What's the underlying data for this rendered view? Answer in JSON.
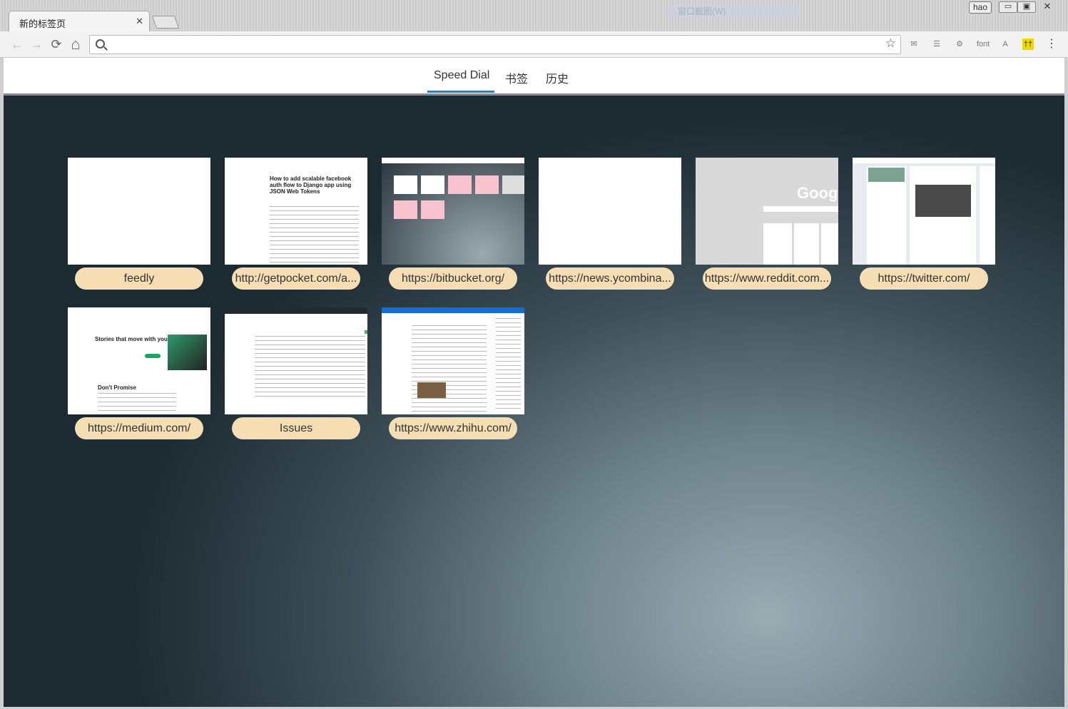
{
  "window": {
    "tab_title": "新的标签页",
    "tab_close": "✕",
    "user": "hao",
    "minimize": "▭",
    "restore": "▣",
    "close": "✕",
    "ghost_text": "窗口截图(W)"
  },
  "toolbar": {
    "back": "←",
    "forward": "→",
    "reload": "⟳",
    "home": "⌂",
    "address_value": "",
    "star": "☆",
    "extensions": [
      "✉",
      "☰",
      "⚙",
      "font",
      "A",
      "††",
      "⋮"
    ]
  },
  "page_tabs": [
    "Speed Dial",
    "书签",
    "历史"
  ],
  "active_tab": "Speed Dial",
  "colors": {
    "label_bg": "#f5deb3",
    "active_underline": "#1e88c8"
  },
  "dials": [
    {
      "label": "feedly",
      "thumb": "blank"
    },
    {
      "label": "http://getpocket.com/a...",
      "thumb": "article",
      "heading": "How to add scalable facebook auth flow to Django app using JSON Web Tokens"
    },
    {
      "label": "https://bitbucket.org/",
      "thumb": "dark-grid"
    },
    {
      "label": "https://news.ycombina...",
      "thumb": "blank"
    },
    {
      "label": "https://www.reddit.com...",
      "thumb": "google",
      "heading": "Googl"
    },
    {
      "label": "https://twitter.com/",
      "thumb": "twitter"
    },
    {
      "label": "https://medium.com/",
      "thumb": "medium",
      "heading": "Stories that move with you.",
      "subheading": "Don't Promise"
    },
    {
      "label": "Issues",
      "thumb": "github"
    },
    {
      "label": "https://www.zhihu.com/",
      "thumb": "zhihu"
    }
  ]
}
